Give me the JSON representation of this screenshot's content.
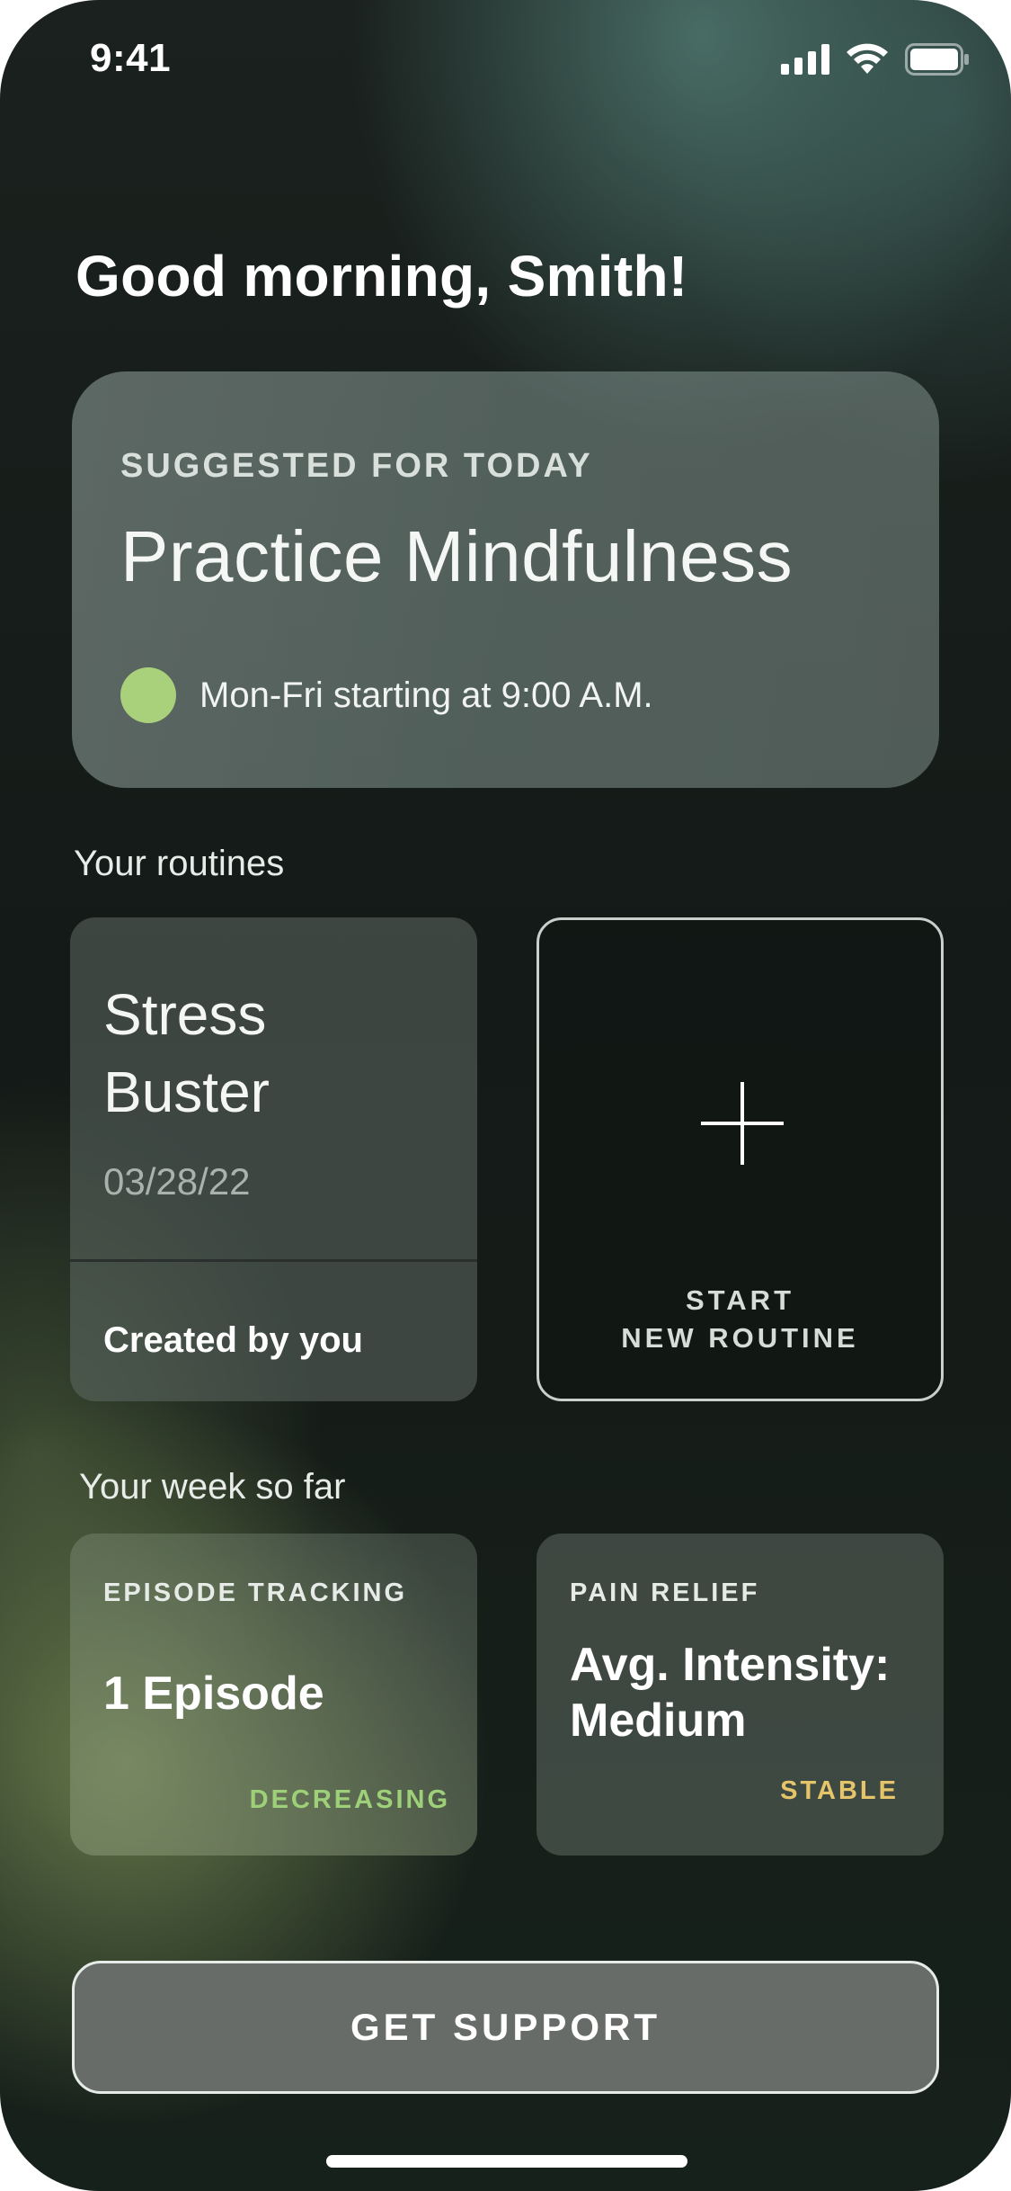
{
  "status_bar": {
    "time": "9:41",
    "icons": [
      "cellular-signal-icon",
      "wifi-icon",
      "battery-icon"
    ]
  },
  "greeting": "Good morning, Smith!",
  "suggested": {
    "eyebrow": "SUGGESTED FOR TODAY",
    "title": "Practice Mindfulness",
    "schedule": "Mon-Fri starting at 9:00 A.M.",
    "dot_color": "#a9d07a"
  },
  "routines": {
    "section_label": "Your routines",
    "items": [
      {
        "name_line1": "Stress",
        "name_line2": "Buster",
        "date": "03/28/22",
        "creator": "Created by you"
      }
    ],
    "new_routine": {
      "icon": "plus-icon",
      "label_line1": "START",
      "label_line2": "NEW ROUTINE"
    }
  },
  "week": {
    "section_label": "Your week so far",
    "cards": [
      {
        "eyebrow": "EPISODE TRACKING",
        "value_line1": "1 Episode",
        "value_line2": "",
        "trend": "DECREASING",
        "trend_color": "#9ed07a"
      },
      {
        "eyebrow": "PAIN RELIEF",
        "value_line1": "Avg. Intensity:",
        "value_line2": "Medium",
        "trend": "STABLE",
        "trend_color": "#e6c56a"
      }
    ]
  },
  "support_button": "GET SUPPORT"
}
